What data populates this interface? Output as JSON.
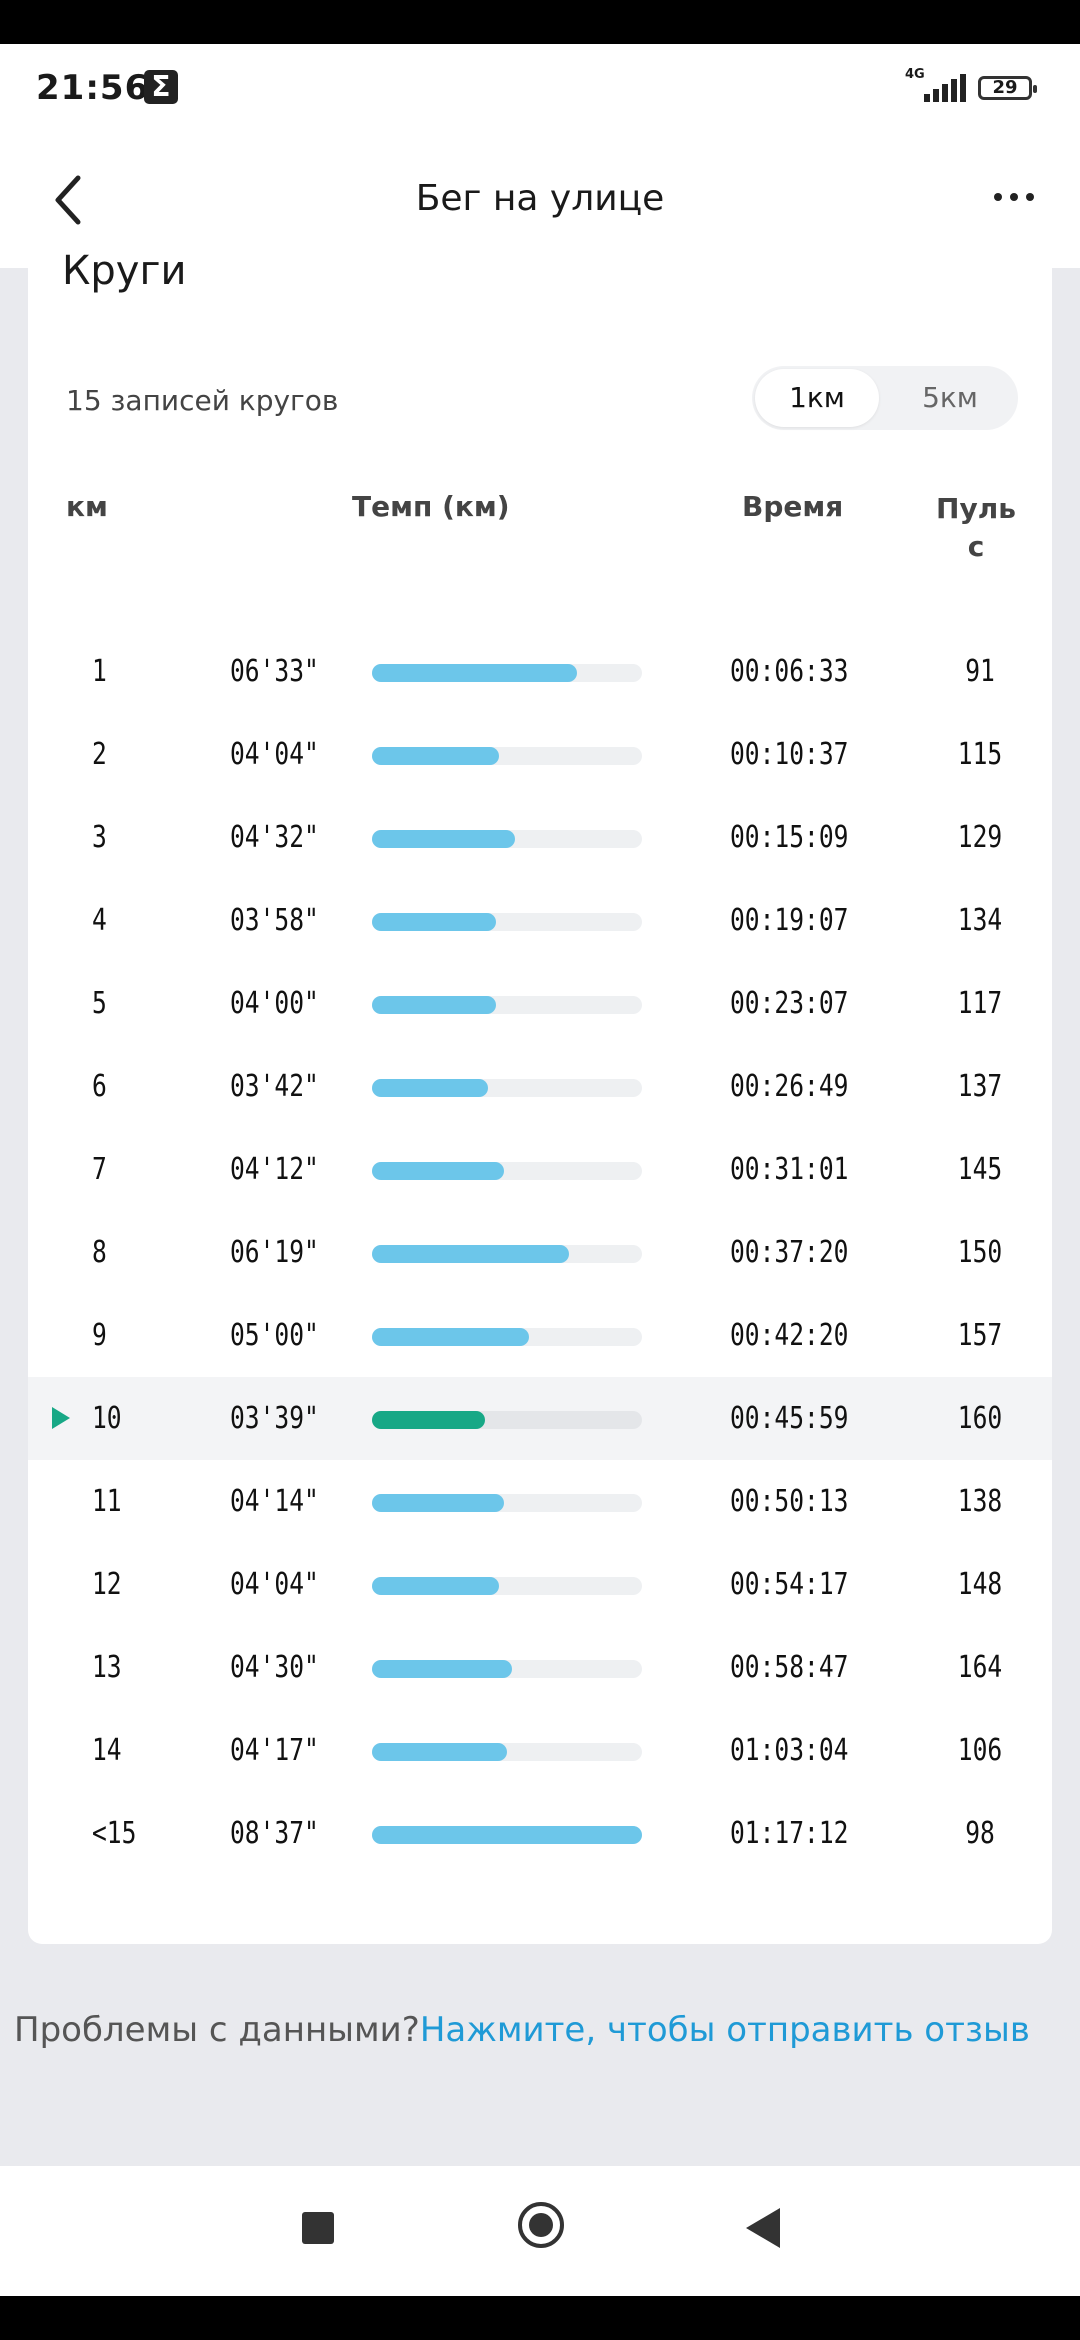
{
  "status_bar": {
    "time": "21:56",
    "network": "4G",
    "battery": "29"
  },
  "header": {
    "title": "Бег на улице"
  },
  "section": {
    "title": "Круги",
    "laps_count": "15 записей кругов",
    "toggle": {
      "option_1": "1км",
      "option_2": "5км",
      "selected": "1км"
    }
  },
  "table": {
    "headers": {
      "km": "км",
      "pace": "Темп (км)",
      "time": "Время",
      "pulse": "Пуль с"
    },
    "rows": [
      {
        "km": "1",
        "pace": "06'33\"",
        "pace_fraction": 0.76,
        "time": "00:06:33",
        "pulse": "91"
      },
      {
        "km": "2",
        "pace": "04'04\"",
        "pace_fraction": 0.47,
        "time": "00:10:37",
        "pulse": "115"
      },
      {
        "km": "3",
        "pace": "04'32\"",
        "pace_fraction": 0.53,
        "time": "00:15:09",
        "pulse": "129"
      },
      {
        "km": "4",
        "pace": "03'58\"",
        "pace_fraction": 0.46,
        "time": "00:19:07",
        "pulse": "134"
      },
      {
        "km": "5",
        "pace": "04'00\"",
        "pace_fraction": 0.46,
        "time": "00:23:07",
        "pulse": "117"
      },
      {
        "km": "6",
        "pace": "03'42\"",
        "pace_fraction": 0.43,
        "time": "00:26:49",
        "pulse": "137"
      },
      {
        "km": "7",
        "pace": "04'12\"",
        "pace_fraction": 0.49,
        "time": "00:31:01",
        "pulse": "145"
      },
      {
        "km": "8",
        "pace": "06'19\"",
        "pace_fraction": 0.73,
        "time": "00:37:20",
        "pulse": "150"
      },
      {
        "km": "9",
        "pace": "05'00\"",
        "pace_fraction": 0.58,
        "time": "00:42:20",
        "pulse": "157"
      },
      {
        "km": "10",
        "pace": "03'39\"",
        "pace_fraction": 0.42,
        "time": "00:45:59",
        "pulse": "160",
        "active": true
      },
      {
        "km": "11",
        "pace": "04'14\"",
        "pace_fraction": 0.49,
        "time": "00:50:13",
        "pulse": "138"
      },
      {
        "km": "12",
        "pace": "04'04\"",
        "pace_fraction": 0.47,
        "time": "00:54:17",
        "pulse": "148"
      },
      {
        "km": "13",
        "pace": "04'30\"",
        "pace_fraction": 0.52,
        "time": "00:58:47",
        "pulse": "164"
      },
      {
        "km": "14",
        "pace": "04'17\"",
        "pace_fraction": 0.5,
        "time": "01:03:04",
        "pulse": "106"
      },
      {
        "km": "<15",
        "pace": "08'37\"",
        "pace_fraction": 1.0,
        "time": "01:17:12",
        "pulse": "98"
      }
    ]
  },
  "feedback": {
    "text": "Проблемы с данными?",
    "link": "Нажмите, чтобы отправить отзыв"
  },
  "colors": {
    "bar": "#6cc6ea",
    "active_bar": "#17a886",
    "link": "#1f9ad6"
  }
}
